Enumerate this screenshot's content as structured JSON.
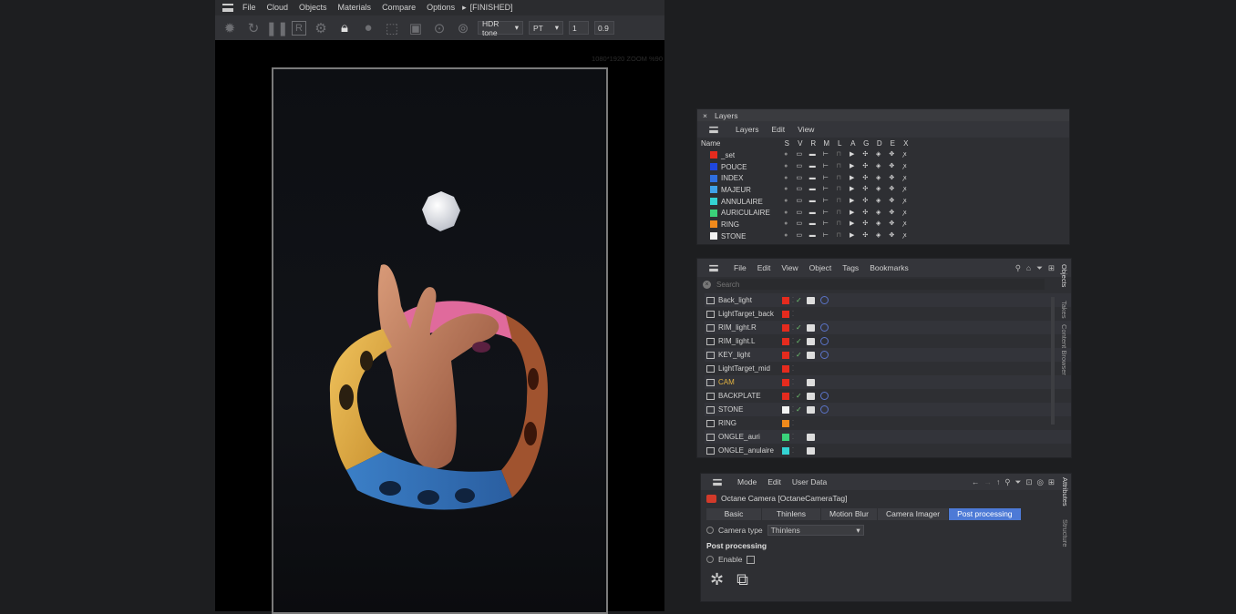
{
  "octane": {
    "menu": [
      "File",
      "Cloud",
      "Objects",
      "Materials",
      "Compare",
      "Options"
    ],
    "status": "[FINISHED]",
    "toolbar": {
      "hdr_tone": "HDR tone",
      "kernel": "PT",
      "num1": "1",
      "num2": "0.9"
    },
    "res_label": "1080*1920 ZOOM %90"
  },
  "layers": {
    "title": "Layers",
    "menu": [
      "Layers",
      "Edit",
      "View"
    ],
    "col_name": "Name",
    "cols": [
      "S",
      "V",
      "R",
      "M",
      "L",
      "A",
      "G",
      "D",
      "E",
      "X"
    ],
    "items": [
      {
        "name": "_set",
        "color": "#e52b1e"
      },
      {
        "name": "POUCE",
        "color": "#1f47e0"
      },
      {
        "name": "INDEX",
        "color": "#2f6fe0"
      },
      {
        "name": "MAJEUR",
        "color": "#3fa2e8"
      },
      {
        "name": "ANNULAIRE",
        "color": "#34d3d3"
      },
      {
        "name": "AURICULAIRE",
        "color": "#3ad17a"
      },
      {
        "name": "RING",
        "color": "#f08a1c"
      },
      {
        "name": "STONE",
        "color": "#f2f2f2"
      }
    ]
  },
  "objects": {
    "menu": [
      "File",
      "Edit",
      "View",
      "Object",
      "Tags",
      "Bookmarks"
    ],
    "search_placeholder": "Search",
    "side_tabs": [
      "Objects",
      "Takes",
      "Content Browser"
    ],
    "items": [
      {
        "name": "Back_light",
        "color": "#e52b1e",
        "check": true,
        "tags": 2
      },
      {
        "name": "LightTarget_back",
        "color": "#e52b1e",
        "check": false,
        "tags": 0
      },
      {
        "name": "RIM_light.R",
        "color": "#e52b1e",
        "check": true,
        "tags": 2
      },
      {
        "name": "RIM_light.L",
        "color": "#e52b1e",
        "check": true,
        "tags": 2
      },
      {
        "name": "KEY_light",
        "color": "#e52b1e",
        "check": true,
        "tags": 2
      },
      {
        "name": "LightTarget_mid",
        "color": "#e52b1e",
        "check": false,
        "tags": 0
      },
      {
        "name": "CAM",
        "color": "#e52b1e",
        "check": false,
        "tags": 1,
        "highlight": true
      },
      {
        "name": "BACKPLATE",
        "color": "#e52b1e",
        "check": true,
        "tags": 2
      },
      {
        "name": "STONE",
        "color": "#f2f2f2",
        "check": true,
        "tags": 2
      },
      {
        "name": "RING",
        "color": "#f08a1c",
        "check": false,
        "tags": 0
      },
      {
        "name": "ONGLE_auri",
        "color": "#3ad17a",
        "check": false,
        "tags": 1
      },
      {
        "name": "ONGLE_anulaire",
        "color": "#34d3d3",
        "check": false,
        "tags": 1
      }
    ]
  },
  "attributes": {
    "menu": [
      "Mode",
      "Edit",
      "User Data"
    ],
    "object_title": "Octane Camera [OctaneCameraTag]",
    "tabs": [
      "Basic",
      "Thinlens",
      "Motion Blur",
      "Camera Imager",
      "Post processing"
    ],
    "active_tab": "Post processing",
    "camera_type_label": "Camera type",
    "camera_type_value": "Thinlens",
    "section": "Post processing",
    "enable_label": "Enable",
    "side_tabs": [
      "Attributes",
      "Structure"
    ]
  }
}
